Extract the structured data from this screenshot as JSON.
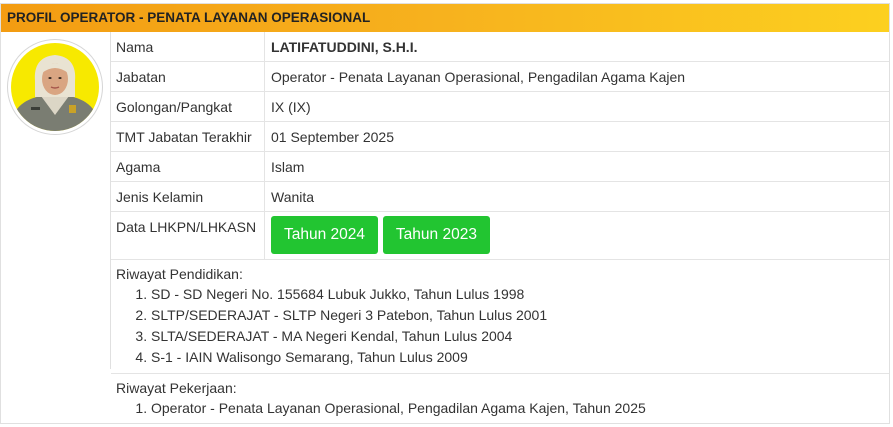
{
  "header": {
    "title": "PROFIL OPERATOR - PENATA LAYANAN OPERASIONAL"
  },
  "profile": {
    "rows": [
      {
        "label": "Nama",
        "value": "LATIFATUDDINI, S.H.I."
      },
      {
        "label": "Jabatan",
        "value": "Operator - Penata Layanan Operasional, Pengadilan Agama Kajen"
      },
      {
        "label": "Golongan/Pangkat",
        "value": "IX (IX)"
      },
      {
        "label": "TMT Jabatan Terakhir",
        "value": "01 September 2025"
      },
      {
        "label": "Agama",
        "value": "Islam"
      },
      {
        "label": "Jenis Kelamin",
        "value": "Wanita"
      }
    ],
    "lhkpn": {
      "label": "Data LHKPN/LHKASN",
      "buttons": [
        "Tahun 2024",
        "Tahun 2023"
      ]
    }
  },
  "pendidikan": {
    "title": "Riwayat Pendidikan:",
    "items": [
      "SD - SD Negeri No. 155684 Lubuk Jukko, Tahun Lulus 1998",
      "SLTP/SEDERAJAT - SLTP Negeri 3 Patebon, Tahun Lulus 2001",
      "SLTA/SEDERAJAT - MA Negeri Kendal, Tahun Lulus 2004",
      "S-1 - IAIN Walisongo Semarang, Tahun Lulus 2009"
    ]
  },
  "pekerjaan": {
    "title": "Riwayat Pekerjaan:",
    "items": [
      "Operator - Penata Layanan Operasional, Pengadilan Agama Kajen, Tahun 2025"
    ]
  },
  "colors": {
    "header_gradient_start": "#f39c12",
    "header_gradient_end": "#fcd01f",
    "button_green": "#22c531",
    "avatar_background": "#f7e900"
  },
  "icons": {
    "avatar": "profile-photo"
  }
}
